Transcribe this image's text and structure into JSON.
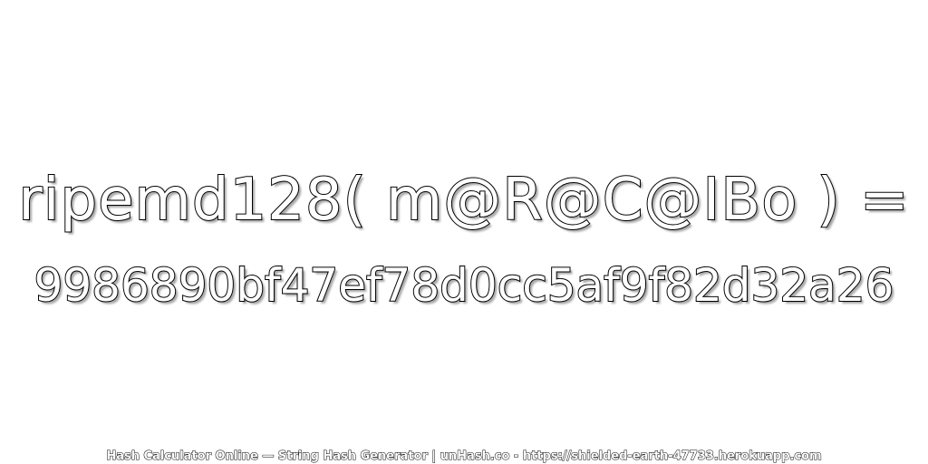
{
  "expression": "ripemd128( m@R@C@IBo ) =",
  "hash": "9986890bf47ef78d0cc5af9f82d32a26",
  "footer": "Hash Calculator Online — String Hash Generator | unHash.co - https://shielded-earth-47733.herokuapp.com"
}
